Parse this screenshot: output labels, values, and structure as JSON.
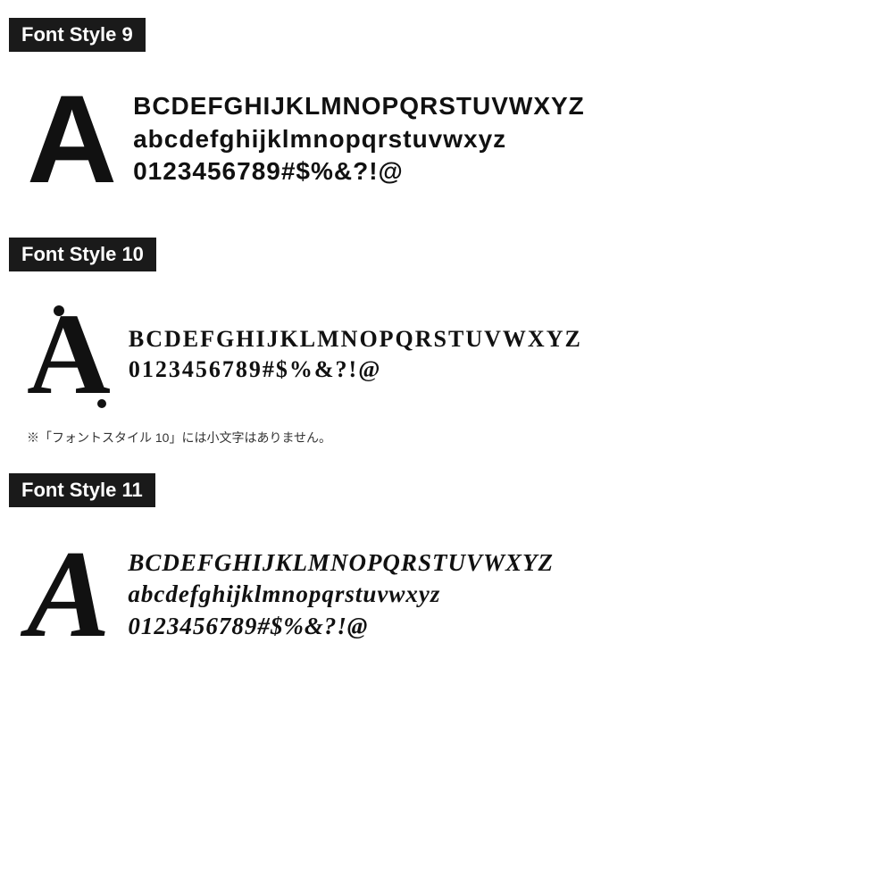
{
  "sections": [
    {
      "id": "style9",
      "title": "Font Style 9",
      "bigLetter": "A",
      "lines": [
        "BCDEFGHIJKLMNOPQRSTUVWXYZ",
        "abcdefghijklmnopqrstuvwxyz",
        "0123456789#$%&?!@"
      ],
      "note": ""
    },
    {
      "id": "style10",
      "title": "Font Style 10",
      "bigLetter": "A",
      "lines": [
        "BCDEFGHIJKLMNOPQRSTUVWXYZ",
        "0123456789#$%&?!@"
      ],
      "note": "※「フォントスタイル 10」には小文字はありません。"
    },
    {
      "id": "style11",
      "title": "Font Style 11",
      "bigLetter": "A",
      "lines": [
        "BCDEFGHIJKLMNOPQRSTUVWXYZ",
        "abcdefghijklmnopqrstuvwxyz",
        "0123456789#$%&?!@"
      ],
      "note": ""
    }
  ]
}
